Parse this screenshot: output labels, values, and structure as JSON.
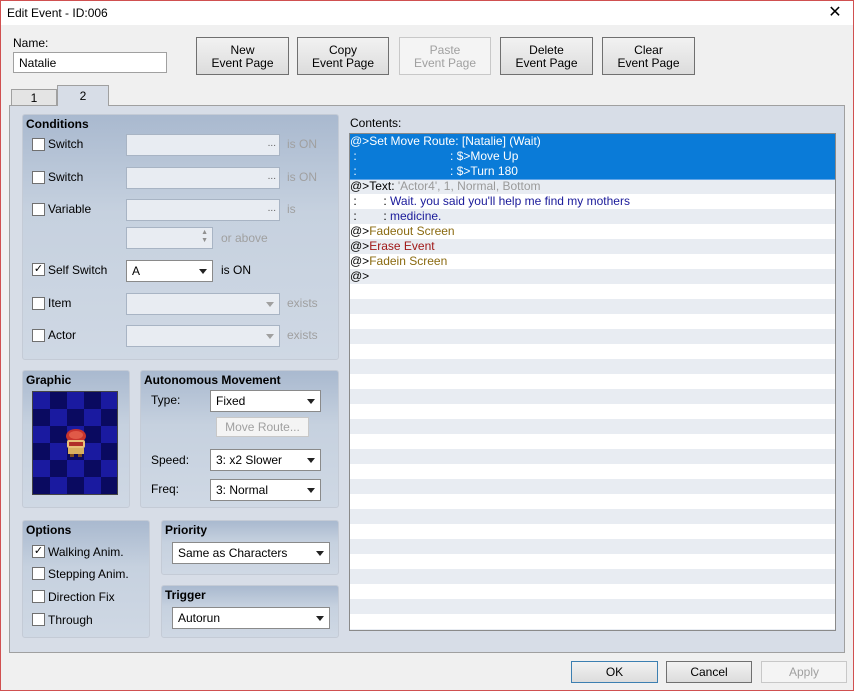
{
  "window": {
    "title": "Edit Event - ID:006",
    "close_glyph": "✕"
  },
  "name": {
    "label": "Name:",
    "value": "Natalie"
  },
  "toolbar": {
    "new": [
      "New",
      "Event Page"
    ],
    "copy": [
      "Copy",
      "Event Page"
    ],
    "paste": [
      "Paste",
      "Event Page"
    ],
    "delete": [
      "Delete",
      "Event Page"
    ],
    "clear": [
      "Clear",
      "Event Page"
    ]
  },
  "tabs": [
    "1",
    "2"
  ],
  "conditions": {
    "title": "Conditions",
    "switch1": {
      "label": "Switch",
      "suffix": "is ON",
      "checked": false
    },
    "switch2": {
      "label": "Switch",
      "suffix": "is ON",
      "checked": false
    },
    "variable": {
      "label": "Variable",
      "suffix": "is",
      "checked": false,
      "spin_suffix": "or above"
    },
    "self_switch": {
      "label": "Self Switch",
      "value": "A",
      "suffix": "is ON",
      "checked": true,
      "check_glyph": "✓"
    },
    "item": {
      "label": "Item",
      "suffix": "exists",
      "checked": false
    },
    "actor": {
      "label": "Actor",
      "suffix": "exists",
      "checked": false
    },
    "ellipsis": "..."
  },
  "graphic": {
    "title": "Graphic"
  },
  "autonomous": {
    "title": "Autonomous Movement",
    "type_label": "Type:",
    "type_value": "Fixed",
    "move_route": "Move Route...",
    "speed_label": "Speed:",
    "speed_value": "3: x2 Slower",
    "freq_label": "Freq:",
    "freq_value": "3: Normal"
  },
  "options": {
    "title": "Options",
    "items": [
      {
        "label": "Walking Anim.",
        "checked": true
      },
      {
        "label": "Stepping Anim.",
        "checked": false
      },
      {
        "label": "Direction Fix",
        "checked": false
      },
      {
        "label": "Through",
        "checked": false
      }
    ]
  },
  "priority": {
    "title": "Priority",
    "value": "Same as Characters"
  },
  "trigger": {
    "title": "Trigger",
    "value": "Autorun"
  },
  "contents": {
    "label": "Contents:",
    "rows": [
      {
        "selected": true,
        "parts": [
          {
            "t": "@>Set Move Route: [Natalie] (Wait)",
            "c": ""
          }
        ]
      },
      {
        "selected": true,
        "parts": [
          {
            "t": " :                            : $>Move Up",
            "c": ""
          }
        ]
      },
      {
        "selected": true,
        "parts": [
          {
            "t": " :                            : $>Turn 180",
            "c": ""
          }
        ]
      },
      {
        "selected": false,
        "parts": [
          {
            "t": "@>Text: ",
            "c": ""
          },
          {
            "t": "'Actor4', 1, Normal, Bottom",
            "c": "gray"
          }
        ]
      },
      {
        "selected": false,
        "parts": [
          {
            "t": " :        : ",
            "c": ""
          },
          {
            "t": "Wait. you said you'll help me find my mothers",
            "c": "navy"
          }
        ]
      },
      {
        "selected": false,
        "parts": [
          {
            "t": " :        : ",
            "c": ""
          },
          {
            "t": "medicine.",
            "c": "navy"
          }
        ]
      },
      {
        "selected": false,
        "parts": [
          {
            "t": "@>",
            "c": ""
          },
          {
            "t": "Fadeout Screen",
            "c": "olive"
          }
        ]
      },
      {
        "selected": false,
        "parts": [
          {
            "t": "@>",
            "c": ""
          },
          {
            "t": "Erase Event",
            "c": "red"
          }
        ]
      },
      {
        "selected": false,
        "parts": [
          {
            "t": "@>",
            "c": ""
          },
          {
            "t": "Fadein Screen",
            "c": "olive"
          }
        ]
      },
      {
        "selected": false,
        "parts": [
          {
            "t": "@>",
            "c": ""
          }
        ]
      }
    ]
  },
  "footer": {
    "ok": "OK",
    "cancel": "Cancel",
    "apply": "Apply"
  },
  "colors": {
    "selection": "#0a7bd8",
    "panel": "#d7dde7"
  }
}
